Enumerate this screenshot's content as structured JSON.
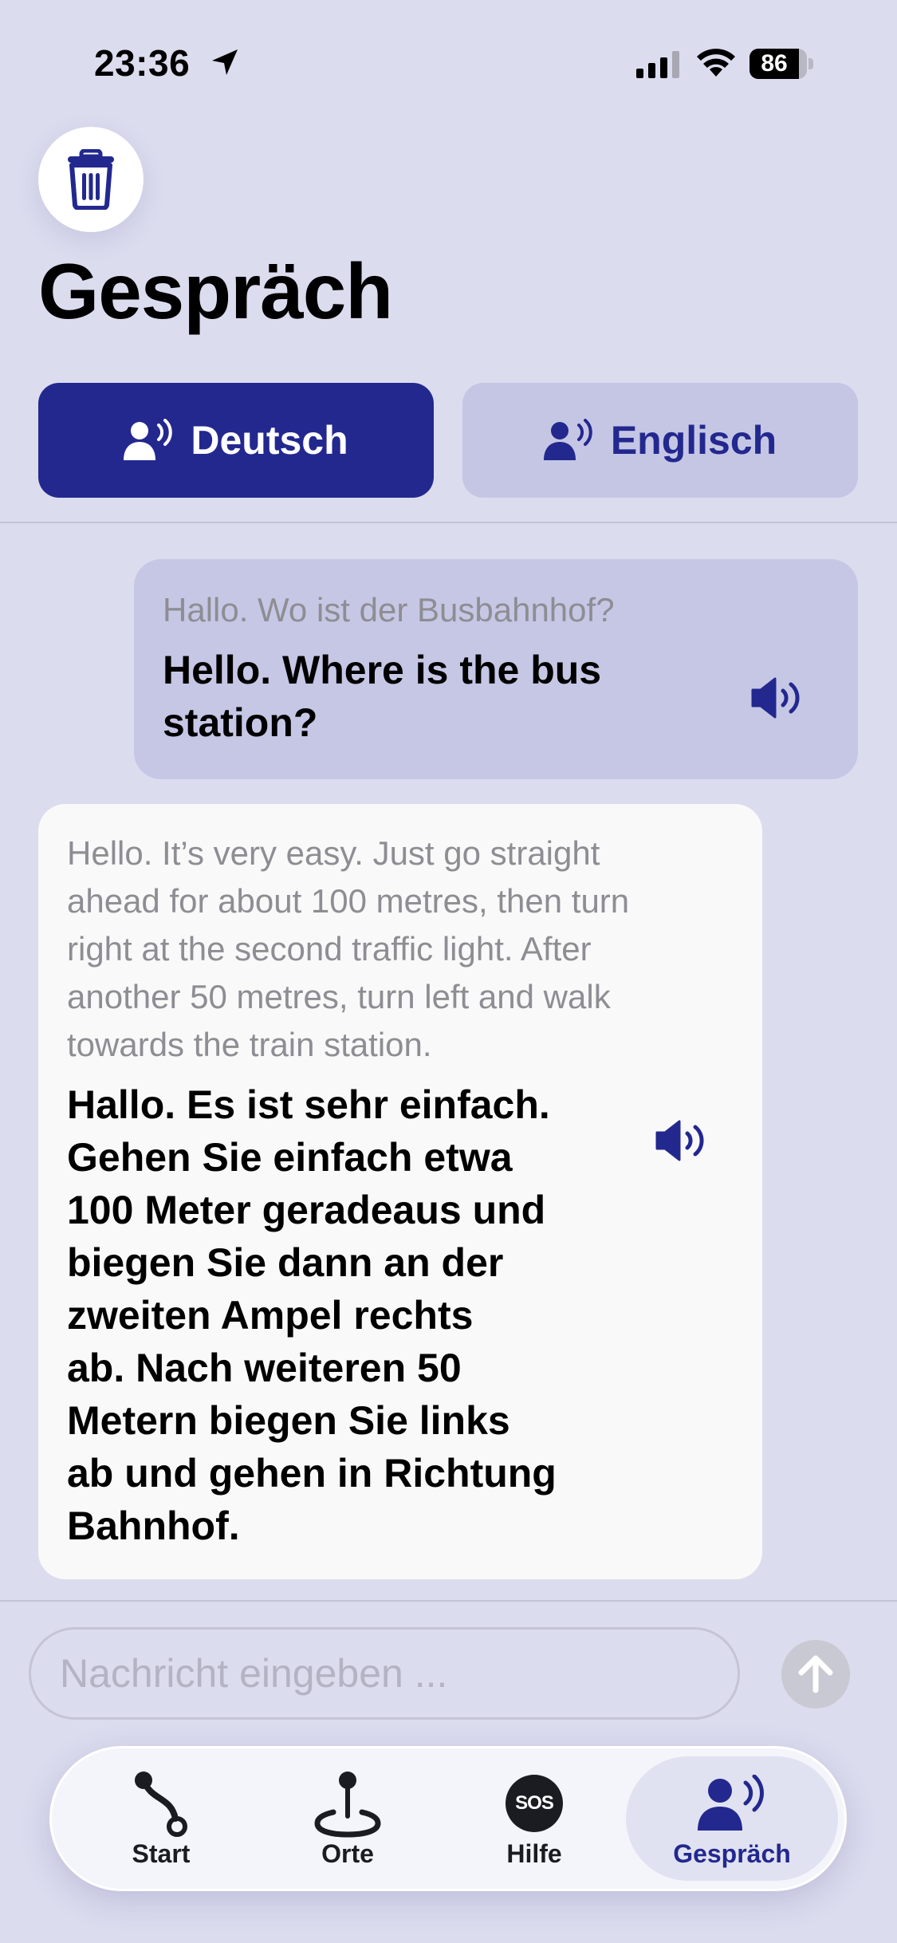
{
  "status_bar": {
    "time": "23:36",
    "battery_level": "86",
    "location_icon": "location-arrow-icon",
    "signal_icon": "cellular-signal-icon",
    "wifi_icon": "wifi-icon"
  },
  "header": {
    "trash_icon": "trash-icon",
    "title": "Gespräch"
  },
  "languages": {
    "active": {
      "label": "Deutsch",
      "icon": "speaking-person-icon"
    },
    "inactive": {
      "label": "Englisch",
      "icon": "speaking-person-icon"
    }
  },
  "messages": [
    {
      "direction": "outgoing",
      "original": "Hallo. Wo ist der Busbahnhof?",
      "translation_lines": [
        "Hello. Where is the bus",
        "station?"
      ],
      "speaker_icon": "speaker-icon"
    },
    {
      "direction": "incoming",
      "original_lines": [
        "Hello. It’s very easy. Just go straight",
        "ahead for about 100 metres, then turn",
        "right at the second traffic light. After",
        "another 50 metres, turn left and walk",
        "towards the train station."
      ],
      "translation_lines": [
        "Hallo. Es ist sehr einfach.",
        "Gehen Sie einfach etwa",
        "100 Meter geradeaus und",
        "biegen Sie dann an der",
        "zweiten Ampel rechts",
        "ab. Nach weiteren 50",
        "Metern biegen Sie links",
        "ab und gehen in Richtung",
        "Bahnhof."
      ],
      "speaker_icon": "speaker-icon"
    }
  ],
  "composer": {
    "placeholder": "Nachricht eingeben ...",
    "send_icon": "arrow-up-icon"
  },
  "tab_bar": {
    "tabs": [
      {
        "label": "Start",
        "icon": "route-icon"
      },
      {
        "label": "Orte",
        "icon": "map-pin-icon"
      },
      {
        "label": "Hilfe",
        "icon": "sos-icon",
        "icon_text": "SOS"
      },
      {
        "label": "Gespräch",
        "icon": "speaking-person-icon",
        "selected": true
      }
    ]
  },
  "colors": {
    "background": "#dcdcef",
    "accent": "#23288f",
    "outgoing_bubble": "#c6c7e5",
    "incoming_bubble": "#f9f9f9"
  }
}
